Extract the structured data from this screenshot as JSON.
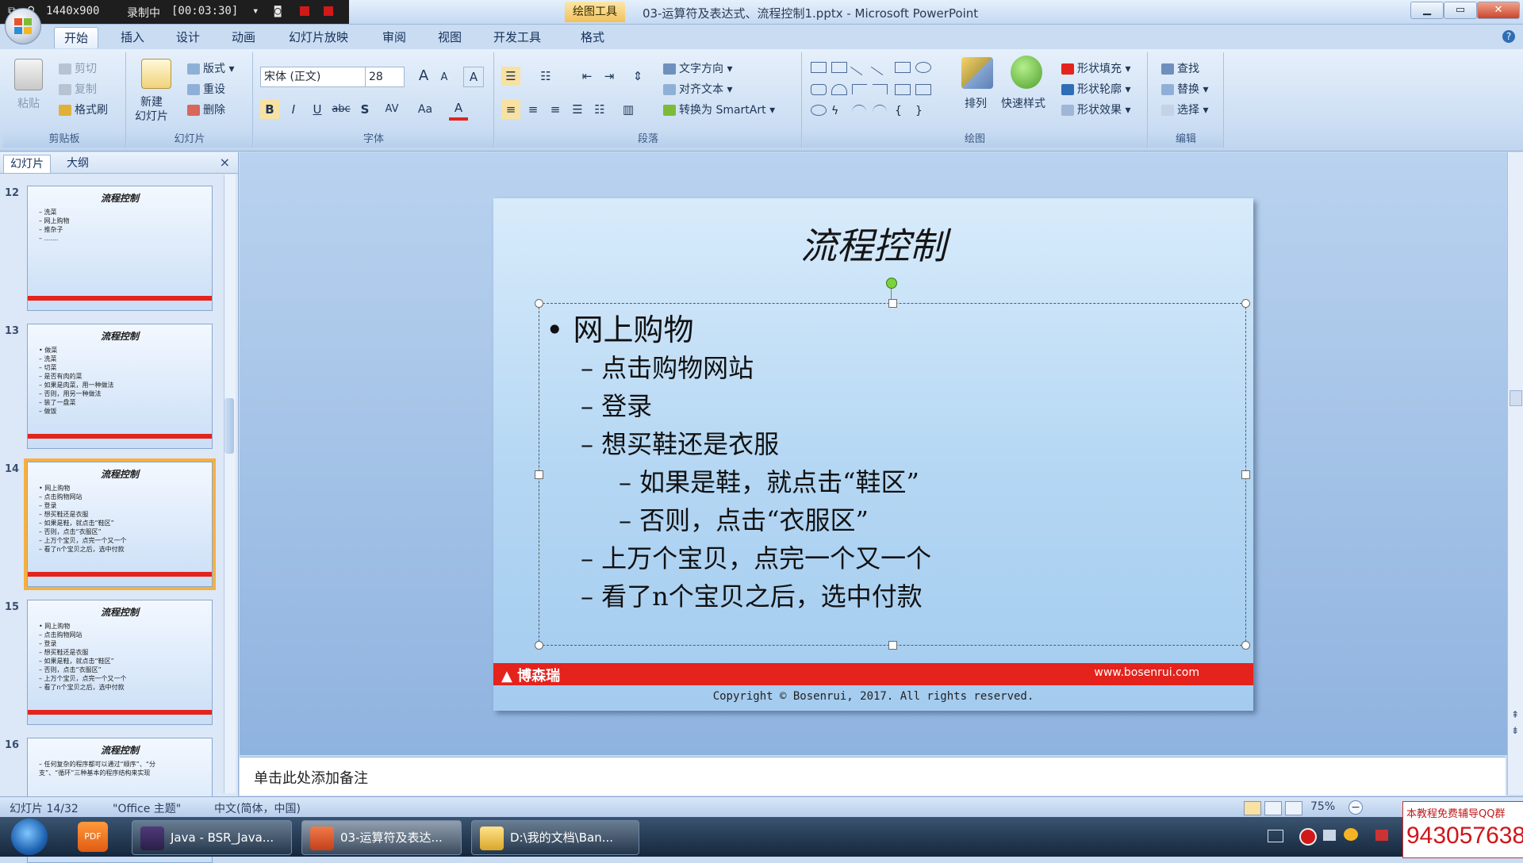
{
  "recorder": {
    "resolution": "1440x900",
    "status": "录制中",
    "time": "[00:03:30]"
  },
  "window": {
    "context_tab": "绘图工具",
    "title": "03-运算符及表达式、流程控制1.pptx - Microsoft PowerPoint",
    "min": "▁",
    "max": "▭",
    "close": "✕"
  },
  "tabs": [
    "开始",
    "插入",
    "设计",
    "动画",
    "幻灯片放映",
    "审阅",
    "视图",
    "开发工具",
    "格式"
  ],
  "ribbon": {
    "clipboard": {
      "paste": "粘贴",
      "cut": "剪切",
      "copy": "复制",
      "painter": "格式刷",
      "name": "剪贴板"
    },
    "slides": {
      "new_slide": "新建\n幻灯片",
      "layout": "版式",
      "reset": "重设",
      "delete": "删除",
      "name": "幻灯片"
    },
    "font": {
      "font_name": "宋体 (正文)",
      "font_size": "28",
      "grow": "A",
      "shrink": "A",
      "clear": "A",
      "bold": "B",
      "italic": "I",
      "underline": "U",
      "strike": "abc",
      "shadow": "S",
      "spacing": "AV",
      "case": "Aa",
      "color": "A",
      "name": "字体"
    },
    "paragraph": {
      "text_direction": "文字方向",
      "align_text": "对齐文本",
      "smartart": "转换为 SmartArt",
      "name": "段落"
    },
    "drawing": {
      "arrange": "排列",
      "quick_styles": "快速样式",
      "fill": "形状填充",
      "outline": "形状轮廓",
      "effects": "形状效果",
      "name": "绘图"
    },
    "editing": {
      "find": "查找",
      "replace": "替换",
      "select": "选择",
      "name": "编辑"
    }
  },
  "pane": {
    "tabs": [
      "幻灯片",
      "大纲"
    ],
    "close": "×",
    "thumbnails": [
      {
        "num": "12",
        "title": "流程控制",
        "lines": [
          "– 洗菜",
          "– 网上购物",
          "– 推杂子",
          "– ......."
        ]
      },
      {
        "num": "13",
        "title": "流程控制",
        "lines": [
          "• 做菜",
          "– 洗菜",
          "– 切菜",
          "– 是否有肉的菜",
          "  – 如果是肉菜，用一种做法",
          "  – 否则，用另一种做法",
          "– 装了一盘菜",
          "– 做饭"
        ]
      },
      {
        "num": "14",
        "title": "流程控制",
        "lines": [
          "• 网上购物",
          "– 点击购物网站",
          "– 登录",
          "– 想买鞋还是衣服",
          "  – 如果是鞋，就点击“鞋区”",
          "  – 否则，点击“衣服区”",
          "– 上万个宝贝，点完一个又一个",
          "– 看了n个宝贝之后，选中付款"
        ]
      },
      {
        "num": "15",
        "title": "流程控制",
        "lines": [
          "• 网上购物",
          "– 点击购物网站",
          "– 登录",
          "– 想买鞋还是衣服",
          "  – 如果是鞋，就点击“鞋区”",
          "  – 否则，点击“衣服区”",
          "– 上万个宝贝，点完一个又一个",
          "– 看了n个宝贝之后，选中付款"
        ]
      },
      {
        "num": "16",
        "title": "流程控制",
        "lines": [
          "– 任何复杂的程序都可以通过“顺序”、“分",
          "支”、“循环”三种基本的程序结构来实现"
        ]
      }
    ]
  },
  "slide": {
    "title": "流程控制",
    "bullets": [
      {
        "text": "网上购物",
        "level": 1
      },
      {
        "text": "点击购物网站",
        "level": 2
      },
      {
        "text": "登录",
        "level": 2
      },
      {
        "text": "想买鞋还是衣服",
        "level": 2
      },
      {
        "text": "如果是鞋，就点击“鞋区”",
        "level": 3
      },
      {
        "text": "否则，点击“衣服区”",
        "level": 3
      },
      {
        "text": "上万个宝贝，点完一个又一个",
        "level": 2
      },
      {
        "text": "看了n个宝贝之后，选中付款",
        "level": 2
      }
    ],
    "footer_logo": "博森瑞",
    "footer_url": "www.bosenrui.com",
    "copyright": "Copyright © Bosenrui, 2017. All rights reserved."
  },
  "notes": {
    "placeholder": "单击此处添加备注"
  },
  "status": {
    "slide_count": "幻灯片 14/32",
    "theme": "\"Office 主题\"",
    "language": "中文(简体，中国)",
    "zoom": "75%",
    "zoom_minus": "−"
  },
  "taskbar": {
    "items": [
      "Java - BSR_Java...",
      "03-运算符及表达...",
      "D:\\我的文档\\Ban..."
    ]
  },
  "promo": {
    "text": "本教程免费辅导QQ群",
    "number": "943057638"
  },
  "colors": {
    "accent_red": "#e4231d",
    "selection": "#f6b040",
    "ribbon": "#cddff4"
  }
}
